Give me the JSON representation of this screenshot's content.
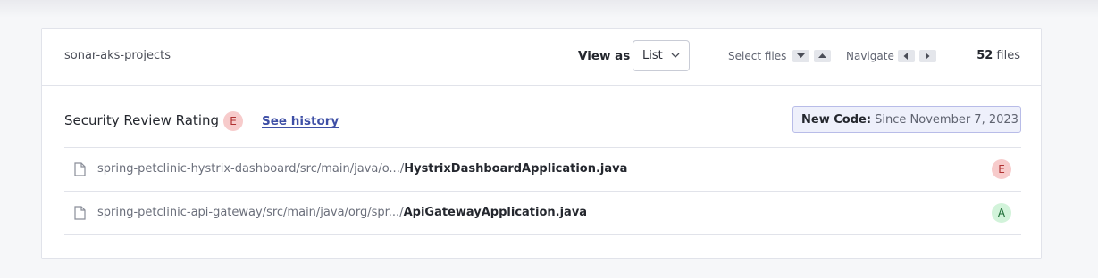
{
  "toolbar": {
    "project_name": "sonar-aks-projects",
    "view_as_label": "View as",
    "view_as_value": "List",
    "select_files_label": "Select files",
    "navigate_label": "Navigate",
    "file_count": "52",
    "file_count_suffix": " files"
  },
  "rating": {
    "title": "Security Review Rating",
    "grade": "E",
    "see_history": "See history",
    "new_code_label": "New Code:",
    "new_code_value": " Since November 7, 2023"
  },
  "files": [
    {
      "dir": "spring-petclinic-hystrix-dashboard/src/main/java/o.../",
      "name": "HystrixDashboardApplication.java",
      "grade": "E"
    },
    {
      "dir": "spring-petclinic-api-gateway/src/main/java/org/spr.../",
      "name": "ApiGatewayApplication.java",
      "grade": "A"
    }
  ],
  "colors": {
    "grade_e": "#f7cbcb",
    "grade_a": "#d2f3da",
    "link": "#3e4fa6"
  },
  "icons": [
    "chevron-down-icon",
    "arrow-down-icon",
    "arrow-up-icon",
    "arrow-left-icon",
    "arrow-right-icon",
    "file-icon"
  ]
}
